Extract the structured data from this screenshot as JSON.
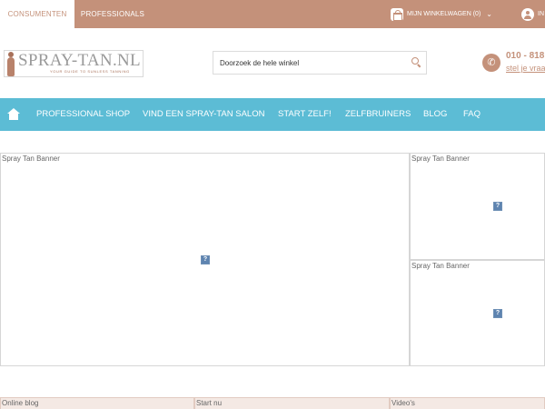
{
  "topbar": {
    "tabs": [
      {
        "label": "CONSUMENTEN",
        "active": true
      },
      {
        "label": "PROFESSIONALS",
        "active": false
      }
    ],
    "cart_label": "MIJN WINKELWAGEN (0)",
    "account_label": "IN"
  },
  "header": {
    "logo_text": "SPRAY-TAN.NL",
    "logo_tagline": "YOUR GUIDE TO SUNLESS TANNING",
    "search_placeholder": "Doorzoek de hele winkel",
    "phone_number": "010 - 818",
    "phone_link": "stel je vraa"
  },
  "nav": {
    "items": [
      {
        "label": "PROFESSIONAL SHOP"
      },
      {
        "label": "VIND EEN SPRAY-TAN SALON"
      },
      {
        "label": "START ZELF!"
      },
      {
        "label": "ZELFBRUINERS"
      },
      {
        "label": "BLOG"
      },
      {
        "label": "FAQ"
      }
    ]
  },
  "banners": [
    {
      "label": "Spray Tan Banner"
    },
    {
      "label": "Spray Tan Banner"
    },
    {
      "label": "Spray Tan Banner"
    }
  ],
  "bottom": [
    {
      "label": "Online blog"
    },
    {
      "label": "Start nu"
    },
    {
      "label": "Video's"
    }
  ],
  "colors": {
    "brand": "#c4917a",
    "nav": "#5cbcd5"
  }
}
